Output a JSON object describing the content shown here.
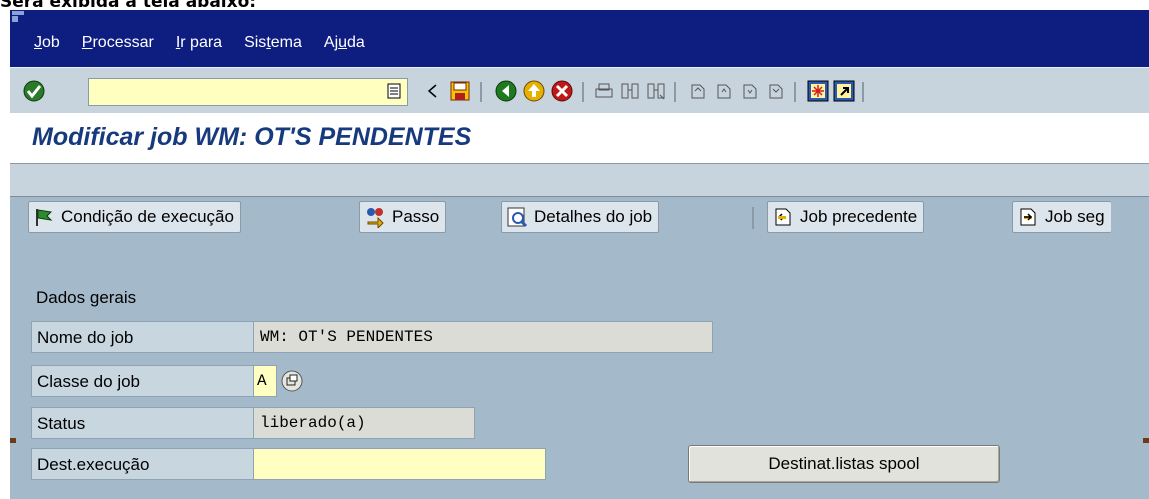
{
  "caption": "Será exibida a tela abaixo:",
  "menu": [
    {
      "pre": "",
      "ul": "J",
      "post": "ob"
    },
    {
      "pre": "",
      "ul": "P",
      "post": "rocessar"
    },
    {
      "pre": "",
      "ul": "I",
      "post": "r para"
    },
    {
      "pre": "Sis",
      "ul": "t",
      "post": "ema"
    },
    {
      "pre": "Aj",
      "ul": "u",
      "post": "da"
    }
  ],
  "command_field": {
    "value": ""
  },
  "title": "Modificar job WM: OT'S PENDENTES",
  "app_toolbar": {
    "condicao": "Condição de execução",
    "passo": "Passo",
    "detalhes": "Detalhes do job",
    "precedente": "Job precedente",
    "seguinte": "Job seg"
  },
  "form": {
    "section": "Dados gerais",
    "nome_label": "Nome do job",
    "nome_value": "WM: OT'S PENDENTES",
    "classe_label": "Classe do job",
    "classe_value": "A",
    "status_label": "Status",
    "status_value": "liberado(a)",
    "dest_label": "Dest.execução",
    "dest_value": "",
    "spool_button": "Destinat.listas spool"
  },
  "colors": {
    "menubar": "#0e1e80",
    "toolbar": "#c7d4dd",
    "background": "#a4bacb",
    "title": "#163a7d",
    "required": "#ffffc2"
  }
}
